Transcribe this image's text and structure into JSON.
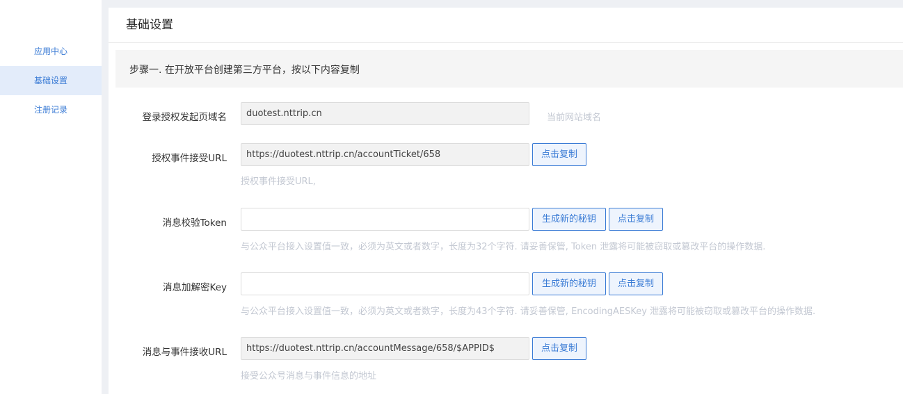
{
  "sidebar": {
    "items": [
      {
        "label": "应用中心"
      },
      {
        "label": "基础设置"
      },
      {
        "label": "注册记录"
      }
    ]
  },
  "header": {
    "title": "基础设置"
  },
  "step": {
    "title": "步骤一. 在开放平台创建第三方平台，按以下内容复制"
  },
  "fields": {
    "domain": {
      "label": "登录授权发起页域名",
      "value": "duotest.nttrip.cn",
      "hint": "当前网站域名"
    },
    "auth_url": {
      "label": "授权事件接受URL",
      "value": "https://duotest.nttrip.cn/accountTicket/658",
      "copy_label": "点击复制",
      "hint": "授权事件接受URL,"
    },
    "token": {
      "label": "消息校验Token",
      "value": "",
      "gen_label": "生成新的秘钥",
      "copy_label": "点击复制",
      "hint": "与公众平台接入设置值一致，必须为英文或者数字，长度为32个字符. 请妥善保管, Token 泄露将可能被窃取或篡改平台的操作数据."
    },
    "key": {
      "label": "消息加解密Key",
      "value": "",
      "gen_label": "生成新的秘钥",
      "copy_label": "点击复制",
      "hint": "与公众平台接入设置值一致，必须为英文或者数字，长度为43个字符. 请妥善保管, EncodingAESKey 泄露将可能被窃取或篡改平台的操作数据."
    },
    "msg_url": {
      "label": "消息与事件接收URL",
      "value": "https://duotest.nttrip.cn/accountMessage/658/$APPID$",
      "copy_label": "点击复制",
      "hint": "接受公众号消息与事件信息的地址"
    }
  },
  "colors": {
    "accent": "#3a7bd5",
    "hint": "#c3c8d2",
    "active_bg": "#e3ecfa"
  }
}
